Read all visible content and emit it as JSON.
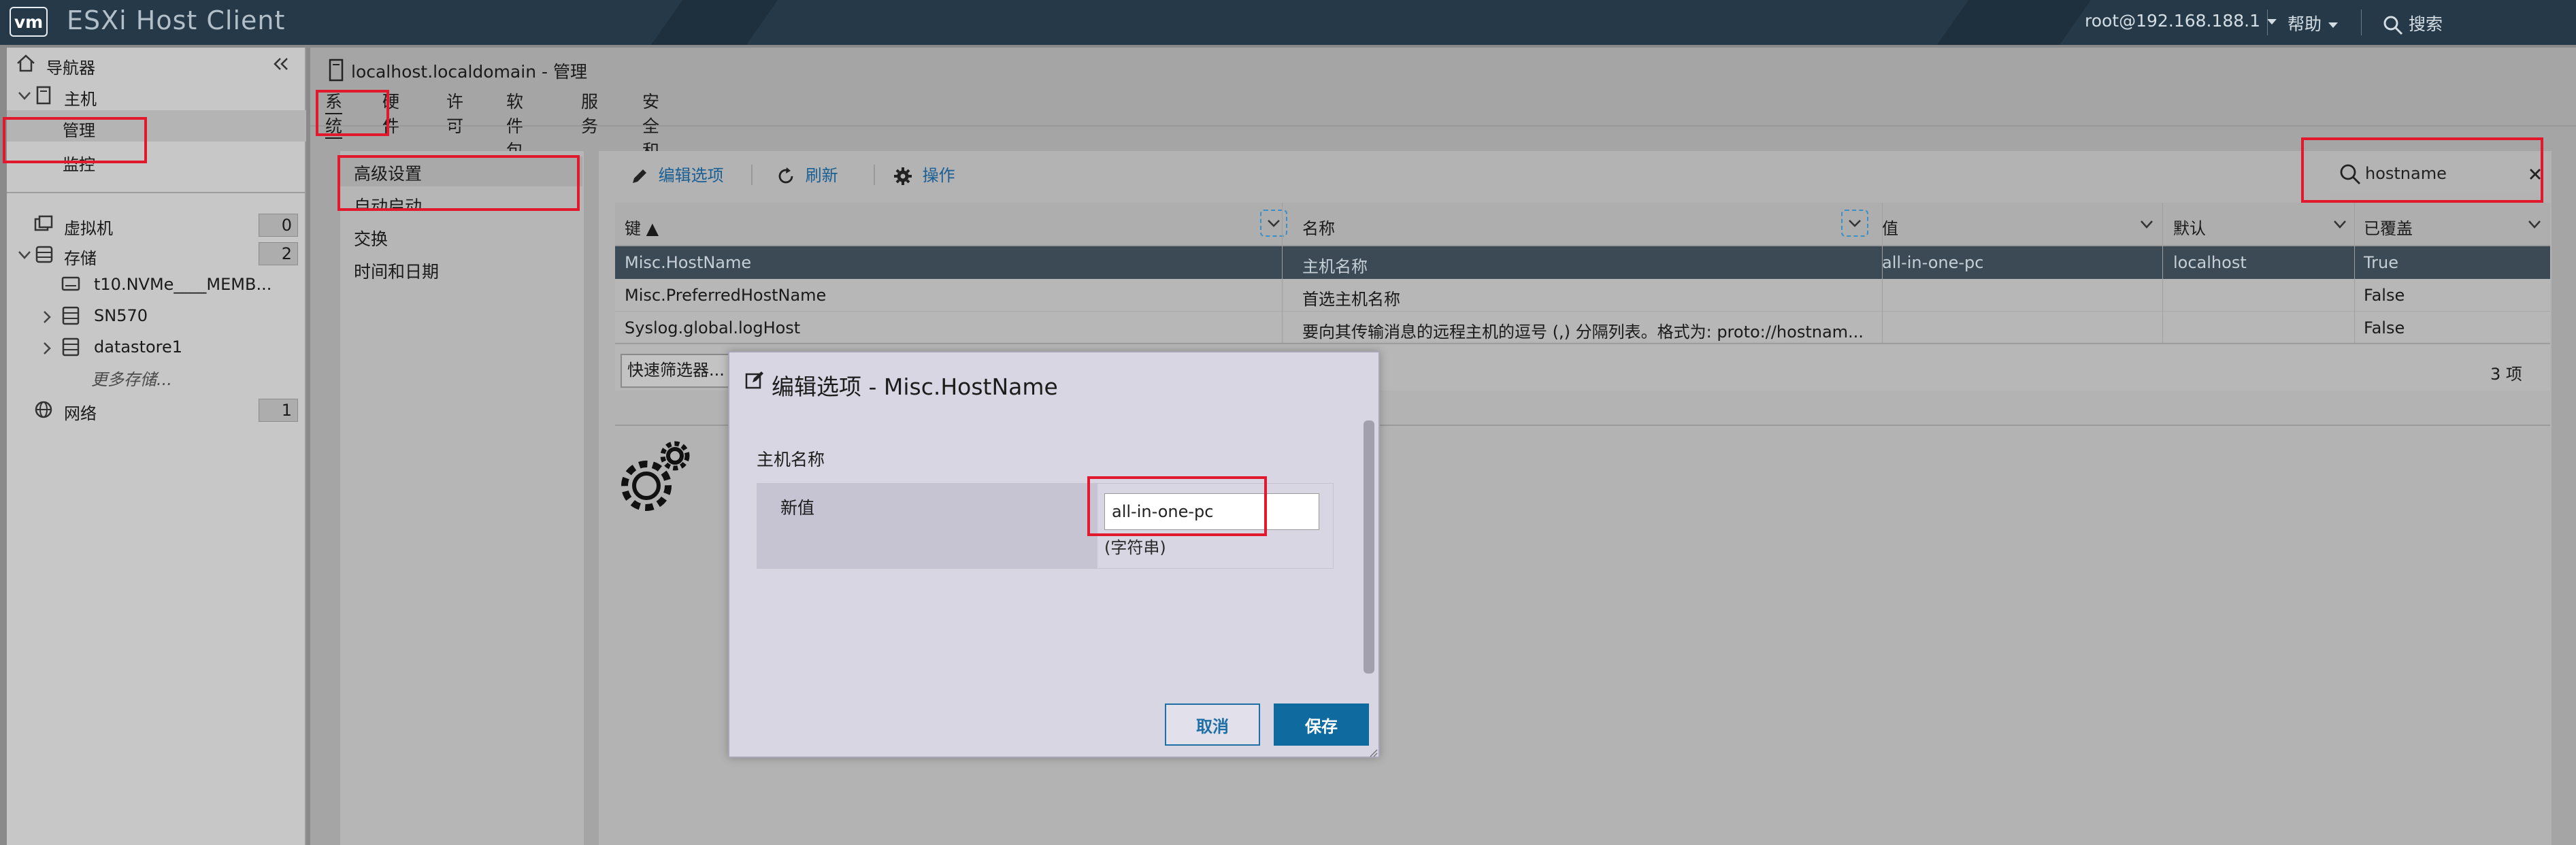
{
  "header": {
    "logo": "vm",
    "app_title": "ESXi Host Client",
    "user": "root@192.168.188.1",
    "help": "帮助",
    "search": "搜索"
  },
  "navigator": {
    "title": "导航器",
    "host": "主机",
    "manage": "管理",
    "monitor": "监控",
    "vms": {
      "label": "虚拟机",
      "count": "0"
    },
    "storage": {
      "label": "存储",
      "count": "2"
    },
    "storage_items": [
      "t10.NVMe____MEMB...",
      "SN570",
      "datastore1"
    ],
    "more_storage": "更多存储...",
    "network": {
      "label": "网络",
      "count": "1"
    }
  },
  "page": {
    "object_title": "localhost.localdomain - 管理",
    "tabs": [
      "系统",
      "硬件",
      "许可",
      "软件包",
      "服务",
      "安全和用户"
    ]
  },
  "left_menu": [
    "高级设置",
    "自动启动",
    "交换",
    "时间和日期"
  ],
  "toolbar": {
    "edit": "编辑选项",
    "refresh": "刷新",
    "actions": "操作",
    "search_value": "hostname"
  },
  "grid": {
    "columns": [
      "键 ▲",
      "名称",
      "值",
      "默认",
      "已覆盖"
    ],
    "rows": [
      {
        "key": "Misc.HostName",
        "name": "主机名称",
        "value": "all-in-one-pc",
        "default": "localhost",
        "overridden": "True"
      },
      {
        "key": "Misc.PreferredHostName",
        "name": "首选主机名称",
        "value": "",
        "default": "",
        "overridden": "False"
      },
      {
        "key": "Syslog.global.logHost",
        "name": "要向其传输消息的远程主机的逗号 (,) 分隔列表。格式为: proto://hostnam...",
        "value": "",
        "default": "",
        "overridden": "False"
      }
    ],
    "quick_filter": "快速筛选器...",
    "count": "3 项"
  },
  "dialog": {
    "title": "编辑选项 - Misc.HostName",
    "section": "主机名称",
    "field_label": "新值",
    "field_value": "all-in-one-pc",
    "field_hint": "(字符串)",
    "cancel": "取消",
    "save": "保存"
  },
  "colors": {
    "topbar": "#253949",
    "accent": "#0f6aa0",
    "highlight": "#e2192c"
  }
}
